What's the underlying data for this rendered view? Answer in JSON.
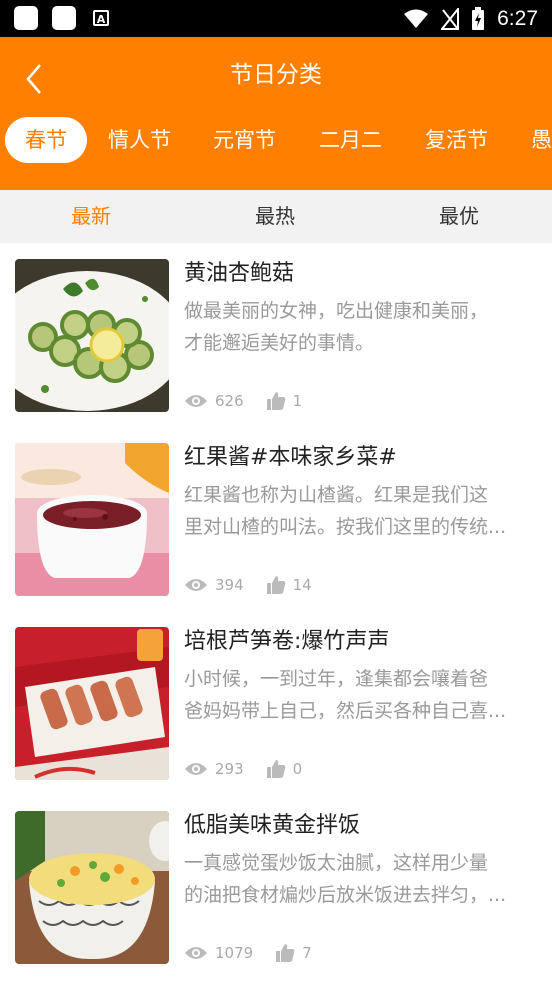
{
  "status_bar": {
    "time": "6:27"
  },
  "header": {
    "title": "节日分类"
  },
  "tabs": [
    {
      "label": "春节",
      "active": true
    },
    {
      "label": "情人节"
    },
    {
      "label": "元宵节"
    },
    {
      "label": "二月二"
    },
    {
      "label": "复活节"
    },
    {
      "label": "愚"
    }
  ],
  "subtabs": [
    {
      "label": "最新",
      "active": true
    },
    {
      "label": "最热"
    },
    {
      "label": "最优"
    }
  ],
  "recipes": [
    {
      "title": "黄油杏鲍菇",
      "desc_line1": "做最美丽的女神，吃出健康和美丽，",
      "desc_line2": "才能邂逅美好的事情。",
      "views": "626",
      "likes": "1"
    },
    {
      "title": "红果酱#本味家乡菜#",
      "desc_line1": "红果酱也称为山楂酱。红果是我们这",
      "desc_line2": "里对山楂的叫法。按我们这里的传统...",
      "views": "394",
      "likes": "14"
    },
    {
      "title": "培根芦笋卷:爆竹声声",
      "desc_line1": "小时候，一到过年，逢集都会嚷着爸",
      "desc_line2": "爸妈妈带上自己，然后买各种自己喜...",
      "views": "293",
      "likes": "0"
    },
    {
      "title": "低脂美味黄金拌饭",
      "desc_line1": "一真感觉蛋炒饭太油腻，这样用少量",
      "desc_line2": "的油把食材煸炒后放米饭进去拌匀，...",
      "views": "1079",
      "likes": "7"
    }
  ],
  "colors": {
    "accent": "#ff7f00",
    "subtab_bg": "#f2f2f2",
    "muted": "#9a9a9a"
  }
}
